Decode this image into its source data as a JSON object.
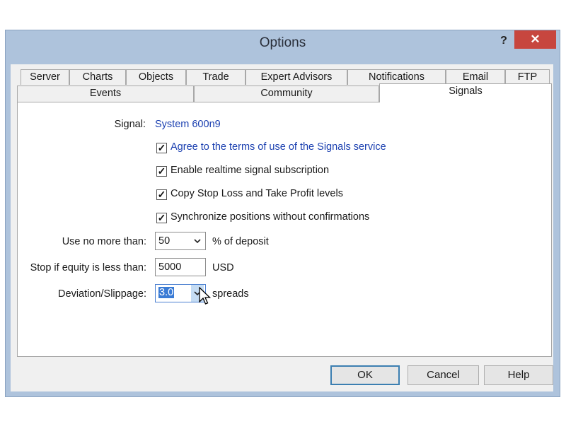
{
  "window": {
    "title": "Options",
    "help_glyph": "?",
    "close_glyph": "✕"
  },
  "tabs_row1": [
    "Server",
    "Charts",
    "Objects",
    "Trade",
    "Expert Advisors",
    "Notifications",
    "Email",
    "FTP"
  ],
  "tabs_row2": [
    "Events",
    "Community",
    "Signals"
  ],
  "active_tab": "Signals",
  "signals": {
    "signal_label": "Signal:",
    "signal_value": "System 600n9",
    "checkboxes": [
      {
        "label": "Agree to the terms of use of the Signals service",
        "checked": true
      },
      {
        "label": "Enable realtime signal subscription",
        "checked": true
      },
      {
        "label": "Copy Stop Loss and Take Profit levels",
        "checked": true
      },
      {
        "label": "Synchronize positions without confirmations",
        "checked": true
      }
    ],
    "use_no_more_label": "Use no more than:",
    "use_no_more_value": "50",
    "use_no_more_suffix": "% of deposit",
    "stop_equity_label": "Stop if equity is less than:",
    "stop_equity_value": "5000",
    "stop_equity_suffix": "USD",
    "deviation_label": "Deviation/Slippage:",
    "deviation_value": "3.0",
    "deviation_suffix": "spreads"
  },
  "buttons": {
    "ok": "OK",
    "cancel": "Cancel",
    "help": "Help"
  },
  "icons": {
    "checkmark": "checkmark-icon",
    "dropdown": "chevron-down-icon",
    "cursor": "mouse-pointer-icon"
  },
  "colors": {
    "title_bar": "#aec3dc",
    "close_button": "#c7463f",
    "link_text": "#1a3fb0",
    "selection": "#3a7bd5"
  }
}
